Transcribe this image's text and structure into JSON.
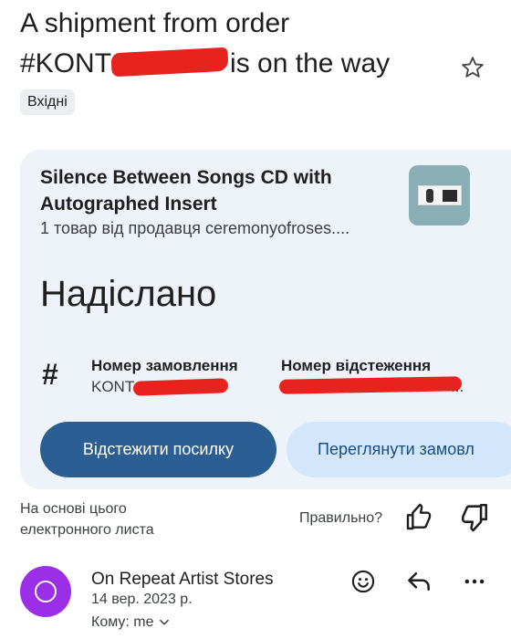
{
  "email": {
    "subject_line1": "A shipment from order",
    "subject_line2_prefix": "#KONT",
    "subject_line2_suffix": "is on the way",
    "label": "Вхідні"
  },
  "card": {
    "product_title": "Silence Between Songs CD with Autographed Insert",
    "product_subtitle": "1 товар від продавця ceremonyofroses....",
    "status": "Надіслано",
    "order_number_label": "Номер замовлення",
    "order_number_value": "KONT",
    "tracking_number_label": "Номер відстеження",
    "tracking_number_value": "...",
    "track_button": "Відстежити посилку",
    "view_order_button": "Переглянути замовл"
  },
  "feedback": {
    "based_on": "На основі цього електронного листа",
    "correct_question": "Правильно?"
  },
  "sender": {
    "name": "On Repeat Artist Stores",
    "date": "14 вер. 2023 р.",
    "recipient": "Кому: me",
    "avatar_color": "#9b2ee6"
  },
  "icons": [
    "star-icon",
    "hash-icon",
    "thumb-up-icon",
    "thumb-down-icon",
    "emoji-icon",
    "reply-icon",
    "more-icon",
    "chevron-down-icon"
  ],
  "colors": {
    "primary_button": "#2b5f94",
    "secondary_button": "#d3e6fb",
    "card_background": "#eef2f9",
    "redaction": "#e8231f"
  }
}
